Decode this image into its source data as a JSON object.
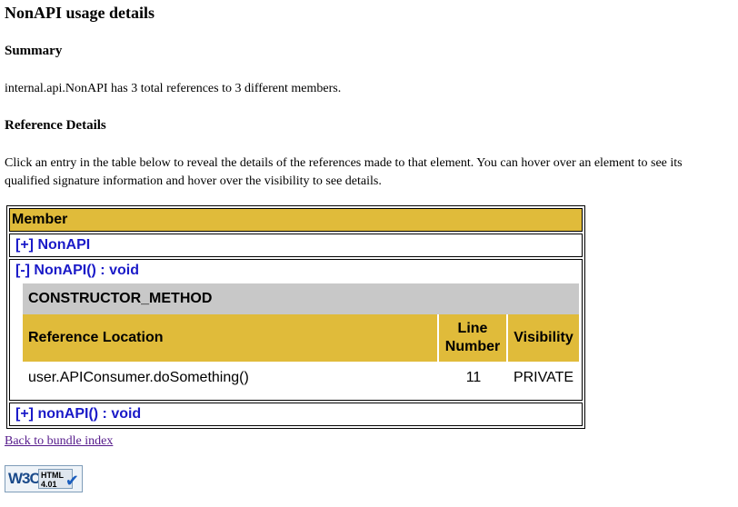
{
  "page": {
    "title": "NonAPI usage details",
    "summary_heading": "Summary",
    "summary_text": "internal.api.NonAPI has 3 total references to 3 different members.",
    "reference_heading": "Reference Details",
    "instructions_line1": "Click an entry in the table below to reveal the details of the references made to that element. You can hover over an element to see its",
    "instructions_line2": "qualified signature information and hover over the visibility to see details."
  },
  "members": {
    "header": "Member",
    "rows": [
      {
        "label": "[+] NonAPI"
      },
      {
        "label": "[-] NonAPI() : void",
        "kind": "CONSTRUCTOR_METHOD",
        "columns": [
          "Reference Location",
          "Line Number",
          "Visibility"
        ],
        "line_col_line1": "Line",
        "line_col_line2": "Number",
        "refs": [
          {
            "location": "user.APIConsumer.doSomething()",
            "line": "11",
            "visibility": "PRIVATE"
          }
        ]
      },
      {
        "label": "[+] nonAPI() : void"
      }
    ]
  },
  "footer": {
    "back_link": "Back to bundle index",
    "w3c_logo": "W3C",
    "w3c_badge_line1": "HTML",
    "w3c_badge_line2": "4.01"
  },
  "colors": {
    "header_gold": "#e0bb3a",
    "ctor_gray": "#c8c8c8",
    "link_blue": "#1a1ac8",
    "visited_purple": "#551a8b"
  }
}
